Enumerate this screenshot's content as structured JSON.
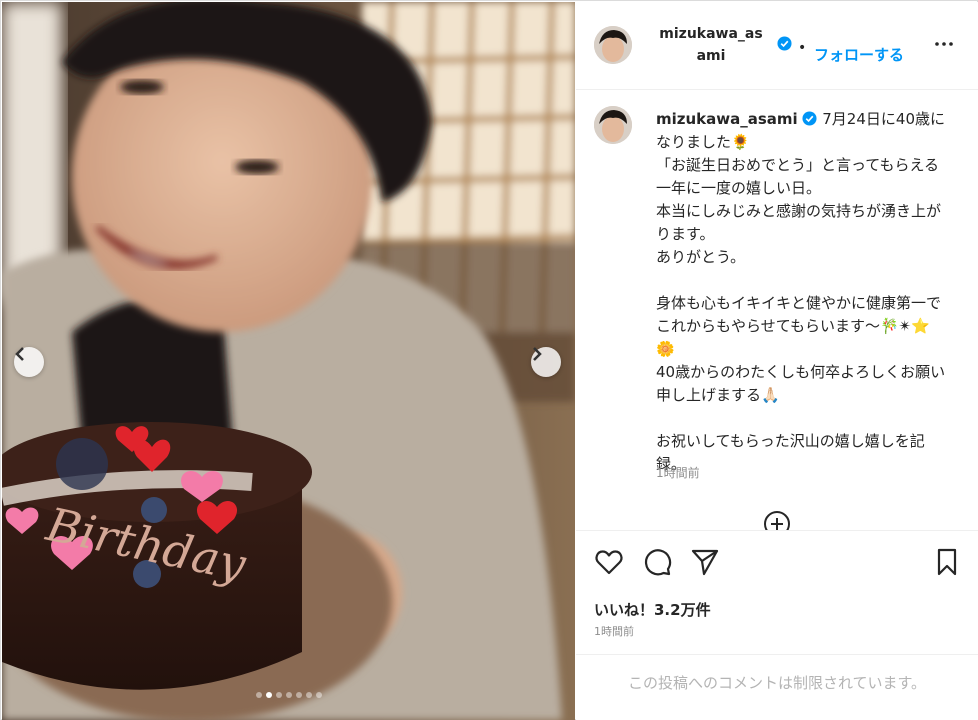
{
  "post": {
    "username": "mizukawa_asami",
    "follow_label": "フォローする",
    "separator": "•",
    "more_icon": "more-horizontal-icon",
    "verified_icon": "verified-badge-icon",
    "verified_color": "#0095f6"
  },
  "caption": {
    "username": "mizukawa_asami",
    "lines": [
      "7月24日に40歳になりました🌻",
      "「お誕生日おめでとう」と言ってもらえる一年に一度の嬉しい日。",
      "本当にしみじみと感謝の気持ちが湧き上がります。",
      "ありがとう。",
      "",
      "身体も心もイキイキと健やかに健康第一でこれからもやらせてもらいます〜🎋✴⭐🌼",
      "40歳からのわたくしも何卒よろしくお願い申し上げまする🙏🏻",
      "",
      "お祝いしてもらった沢山の嬉し嬉しを記録。"
    ],
    "time": "1時間前"
  },
  "actions": {
    "like_icon": "heart-icon",
    "comment_icon": "comment-icon",
    "share_icon": "send-icon",
    "save_icon": "bookmark-icon",
    "likes_text": "いいね！3.2万件",
    "time": "1時間前"
  },
  "comments": {
    "disabled_text": "この投稿へのコメントは制限されています。"
  },
  "carousel": {
    "prev_icon": "chevron-left-icon",
    "next_icon": "chevron-right-icon",
    "slide_count": 7,
    "active_index": 1
  }
}
